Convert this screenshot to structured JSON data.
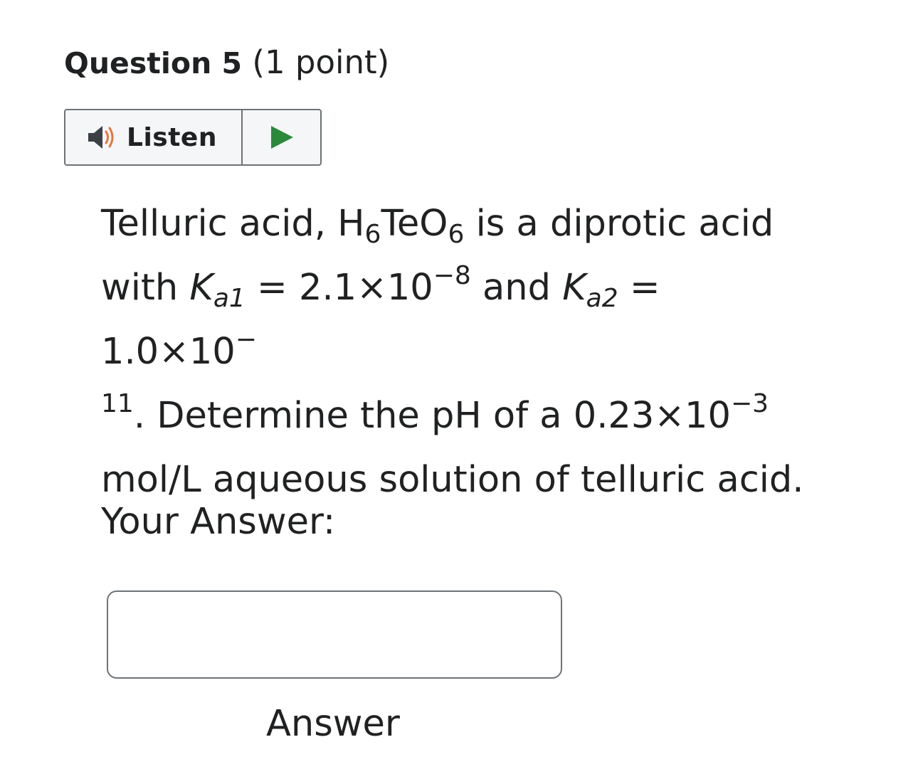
{
  "question": {
    "title": "Question 5",
    "points": " (1 point)"
  },
  "listen": {
    "label": "Listen",
    "speaker_icon": "speaker-icon",
    "play_icon": "play-icon",
    "accent_play": "#2a8a3a",
    "accent_speaker_waves": "#e8743b"
  },
  "prompt": {
    "t1": "Telluric acid, H",
    "sub1": "6",
    "t2": "TeO",
    "sub2": "6",
    "t3": " is a diprotic acid",
    "t4": "with ",
    "k1": "K",
    "k1_sub": "a1",
    "t5": " = 2.1×10",
    "exp1": "−8",
    "t6": " and ",
    "k2": "K",
    "k2_sub": "a2",
    "t7": " = 1.0×10",
    "exp2_a": "−",
    "exp2_b": "11",
    "t8": ". Determine the pH of a 0.23×10",
    "exp3": "−3",
    "t9": "mol/L aqueous solution of telluric acid."
  },
  "answer": {
    "heading": "Your Answer:",
    "value": "",
    "label": "Answer"
  }
}
